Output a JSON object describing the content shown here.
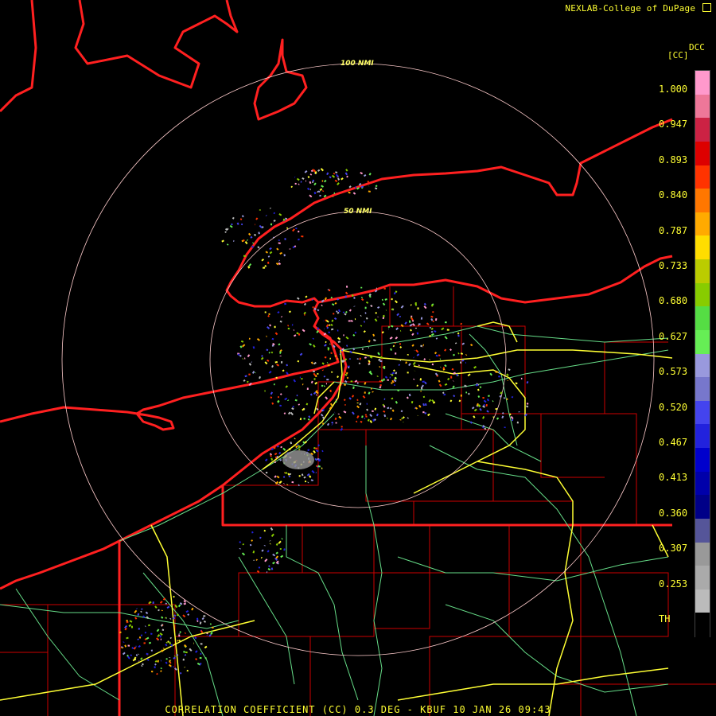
{
  "product": {
    "credit": "NEXLAB-College of DuPage",
    "footer": "CORRELATION COEFFICIENT (CC) 0.3 DEG - KBUF 10 JAN 26 09:43"
  },
  "range_rings": [
    {
      "label": "100 NMI"
    },
    {
      "label": "50 NMI"
    }
  ],
  "legend": {
    "code": "DCC",
    "unit": "[CC]",
    "ticks": [
      "1.000",
      "0.947",
      "0.893",
      "0.840",
      "0.787",
      "0.733",
      "0.680",
      "0.627",
      "0.573",
      "0.520",
      "0.467",
      "0.413",
      "0.360",
      "0.307",
      "0.253",
      "TH"
    ],
    "colors": [
      "#ff99cc",
      "#ee7799",
      "#cc2244",
      "#dd0000",
      "#ff3300",
      "#ff7700",
      "#ffaa00",
      "#ffdd00",
      "#bbcc00",
      "#88cc00",
      "#55dd44",
      "#66ee55",
      "#9999dd",
      "#7777cc",
      "#4444ee",
      "#2222dd",
      "#0000cc",
      "#0000aa",
      "#000088",
      "#555599",
      "#999999",
      "#aaaaaa",
      "#bbbbbb",
      "#000000"
    ]
  },
  "colors": {
    "state_border": "#ff2020",
    "county_border": "#cc0000",
    "interstate": "#ffff33",
    "highway": "#66dd88",
    "range_ring": "#ffcccc",
    "text": "#ffff33"
  }
}
